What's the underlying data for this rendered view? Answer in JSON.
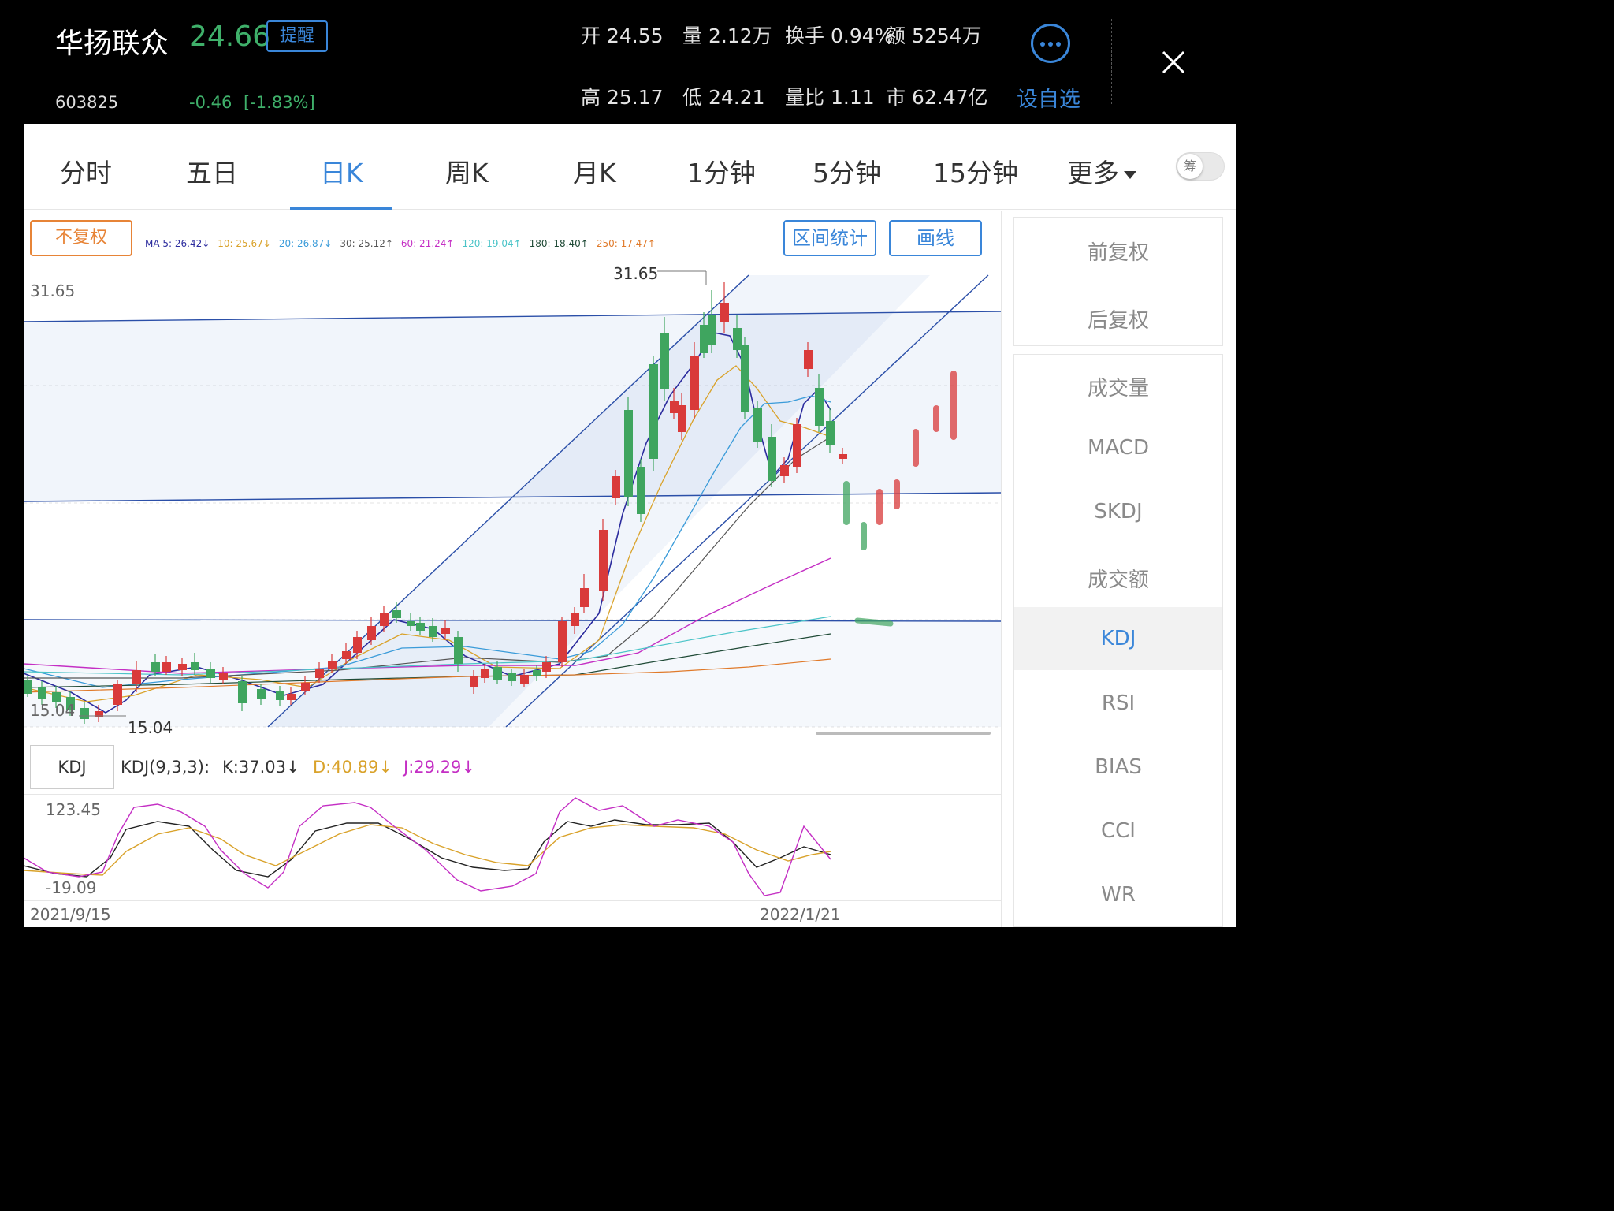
{
  "header": {
    "name": "华扬联众",
    "price": "24.66",
    "remind_label": "提醒",
    "code": "603825",
    "change": "-0.46",
    "change_pct": "[-1.83%]",
    "quotes_row1": [
      {
        "label": "开",
        "value": "24.55"
      },
      {
        "label": "量",
        "value": "2.12万"
      },
      {
        "label": "换手",
        "value": "0.94%"
      },
      {
        "label": "额",
        "value": "5254万"
      }
    ],
    "quotes_row2": [
      {
        "label": "高",
        "value": "25.17"
      },
      {
        "label": "低",
        "value": "24.21"
      },
      {
        "label": "量比",
        "value": "1.11"
      },
      {
        "label": "市",
        "value": "62.47亿"
      }
    ],
    "set_fav_label": "设自选",
    "icons": {
      "more": "more-icon",
      "close": "close-icon"
    }
  },
  "tabs": [
    "分时",
    "五日",
    "日K",
    "周K",
    "月K",
    "1分钟",
    "5分钟",
    "15分钟",
    "更多"
  ],
  "active_tab": "日K",
  "toggle_label": "筹",
  "toolbar": {
    "adjust_label": "不复权",
    "range_stat_label": "区间统计",
    "draw_line_label": "画线"
  },
  "ma_legend": [
    {
      "text": "MA 5: 26.42↓",
      "color": "#2c2c9e"
    },
    {
      "text": "10: 25.67↓",
      "color": "#d9a22a"
    },
    {
      "text": "20: 26.87↓",
      "color": "#3a9bd9"
    },
    {
      "text": "30: 25.12↑",
      "color": "#555555"
    },
    {
      "text": "60: 21.24↑",
      "color": "#c42fc4"
    },
    {
      "text": "120: 19.04↑",
      "color": "#4bc4c8"
    },
    {
      "text": "180: 18.40↑",
      "color": "#1f4a36"
    },
    {
      "text": "250: 17.47↑",
      "color": "#e07a2a"
    }
  ],
  "price_chart": {
    "y_max_label": "31.65",
    "y_min_label": "15.04",
    "high_marker": "31.65",
    "low_marker": "15.04",
    "colors": {
      "up": "#d93a3a",
      "down": "#3fa55f"
    }
  },
  "kdj": {
    "box_label": "KDJ",
    "params": "KDJ(9,3,3):",
    "k": "K:37.03↓",
    "d": "D:40.89↓",
    "j": "J:29.29↓",
    "y_max_label": "123.45",
    "y_min_label": "-19.09",
    "colors": {
      "k": "#222222",
      "d": "#d9a22a",
      "j": "#c42fc4"
    }
  },
  "x_axis": {
    "start": "2021/9/15",
    "end": "2022/1/21"
  },
  "side_menu_top": [
    "前复权",
    "后复权"
  ],
  "side_menu_bottom": [
    "成交量",
    "MACD",
    "SKDJ",
    "成交额",
    "KDJ",
    "RSI",
    "BIAS",
    "CCI",
    "WR"
  ],
  "side_active": "KDJ"
}
